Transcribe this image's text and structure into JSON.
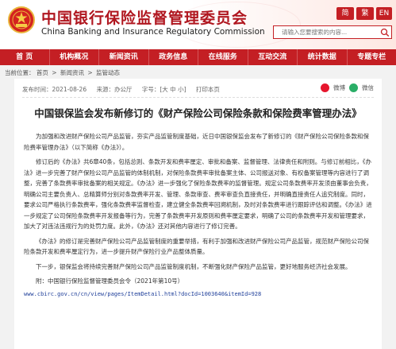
{
  "header": {
    "title_cn": "中国银行保险监督管理委员会",
    "title_en": "China Banking and Insurance Regulatory Commission",
    "lang": [
      "简",
      "繁",
      "EN"
    ],
    "search_placeholder": "请输入您要搜索的内容..."
  },
  "nav": [
    "首 页",
    "机构概况",
    "新闻资讯",
    "政务信息",
    "在线服务",
    "互动交流",
    "统计数据",
    "专题专栏"
  ],
  "breadcrumb": [
    "当前位置：",
    "首页",
    "新闻资讯",
    "监管动态"
  ],
  "article": {
    "time": "发布时间：2021-08-26",
    "source": "来源：办公厅",
    "font": "字号：[大 中 小]",
    "print": "打印本页",
    "share": [
      "微博",
      "微信"
    ],
    "title": "中国银保监会发布新修订的《财产保险公司保险条款和保险费率管理办法》",
    "paragraphs": [
      "为加强和改进财产保险公司产品监管，夯实产品监管制度基础，近日中国银保监会发布了新修订的《财产保险公司保险条款和保险费率管理办法》（以下简称《办法》）。",
      "修订后的《办法》共6章40条，包括总则、条款开发和费率厘定、审批和备案、监督管理、法律责任和附则。与修订前相比，《办法》进一步完善了财产保险公司产品监管的体制机制，对保险条款费率审批备案主体、公司报送对象、有权备案管理等内容进行了调整，完善了条款费率审批备案的相关规定。《办法》进一步强化了保险条款费率的监督管理。规定公司条款费率开发须由董事会负责，明确公司主要负责人、总精算师分别对条款费率开发、管理、条款审查、费率审查负直接责任，并明确直接责任人追究制度。同时，要求公司严格执行条款费率，强化条款费率监督检查，建立健全条款费率回溯机制，及时对条款费率进行跟踪评估和调整。《办法》进一步规定了公司保险条款费率开发报备等行为，完善了条款费率开发原则和费率厘定要求，明确了公司的条款费率开发和管理要求，加大了对违法违规行为的处罚力度。此外，《办法》还对其他内容进行了修订完善。",
      "《办法》的修订是完善财产保险公司产品监管制度的重要举措，有利于加强和改进财产保险公司产品监管，规范财产保险公司保险条款开发和费率厘定行为，进一步提升财产保险行业产品整体质量。",
      "下一步，银保监会将持续完善财产保险公司产品监管制度机制，不断强化财产保险产品监管，更好地服务经济社会发展。"
    ],
    "attachment": "附：中国银行保险监督管理委员会令（2021年第10号）",
    "link": "www.cbirc.gov.cn/cn/view/pages/ItemDetail.html?docId=1003640&itemId=928"
  },
  "colors": {
    "brand_red": "#c41f24",
    "title_red": "#b0161f",
    "link_blue": "#1f3f9a"
  }
}
